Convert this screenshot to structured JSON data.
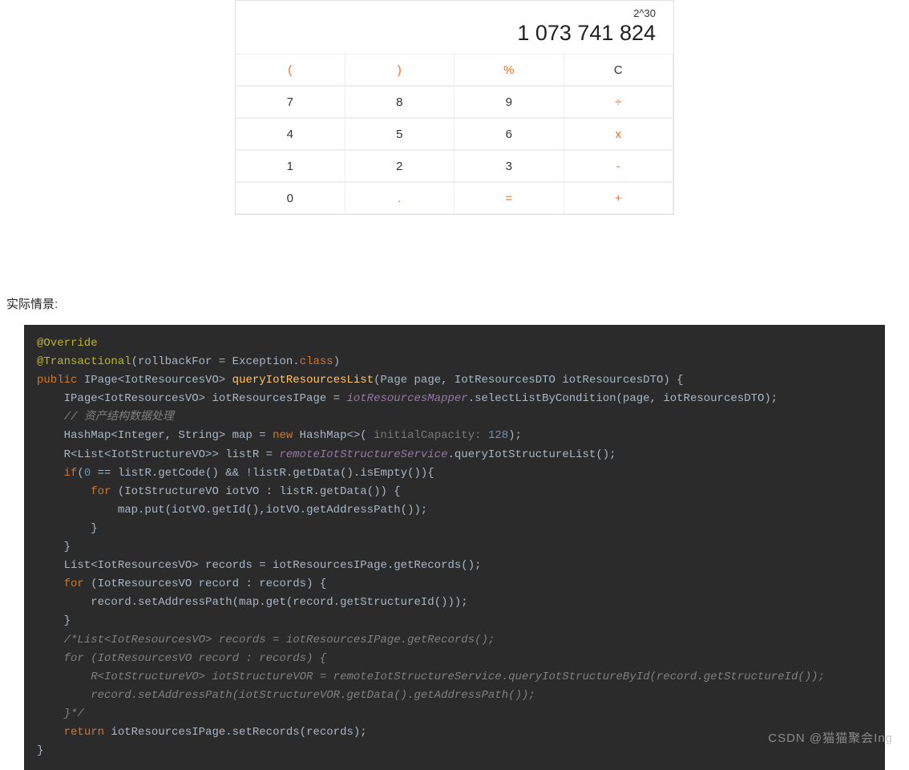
{
  "calculator": {
    "expression": "2^30",
    "result": "1 073 741 824",
    "rows": [
      [
        {
          "label": "(",
          "orange": true
        },
        {
          "label": ")",
          "orange": true
        },
        {
          "label": "%",
          "orange": true
        },
        {
          "label": "C",
          "orange": false
        }
      ],
      [
        {
          "label": "7",
          "orange": false
        },
        {
          "label": "8",
          "orange": false
        },
        {
          "label": "9",
          "orange": false
        },
        {
          "label": "÷",
          "orange": true
        }
      ],
      [
        {
          "label": "4",
          "orange": false
        },
        {
          "label": "5",
          "orange": false
        },
        {
          "label": "6",
          "orange": false
        },
        {
          "label": "x",
          "orange": true
        }
      ],
      [
        {
          "label": "1",
          "orange": false
        },
        {
          "label": "2",
          "orange": false
        },
        {
          "label": "3",
          "orange": false
        },
        {
          "label": "-",
          "orange": true
        }
      ],
      [
        {
          "label": "0",
          "orange": false
        },
        {
          "label": ".",
          "orange": true
        },
        {
          "label": "=",
          "orange": true
        },
        {
          "label": "+",
          "orange": true
        }
      ]
    ]
  },
  "heading": "实际情景:",
  "code": {
    "line1_ann": "@Override",
    "line2_ann": "@Transactional",
    "line2_param": "rollbackFor",
    "line2_cls": "Exception",
    "line2_class_kw": "class",
    "line3_public": "public",
    "line3_ret": "IPage<IotResourcesVO>",
    "line3_method": "queryIotResourcesList",
    "line3_params": "(Page page, IotResourcesDTO iotResourcesDTO) {",
    "line4": "IPage<IotResourcesVO> iotResourcesIPage = ",
    "line4_field": "iotResourcesMapper",
    "line4_rest": ".selectListByCondition(page, iotResourcesDTO);",
    "line5_comment": "// 资产结构数据处理",
    "line6a": "HashMap<Integer, String> map = ",
    "line6_new": "new",
    "line6b": " HashMap<>(",
    "line6_hint": " initialCapacity: ",
    "line6_num": "128",
    "line6c": ");",
    "line7a": "R<List<IotStructureVO>> listR = ",
    "line7_field": "remoteIotStructureService",
    "line7b": ".queryIotStructureList();",
    "line8_if": "if",
    "line8a": "(",
    "line8_zero": "0",
    "line8b": " == listR.getCode() && !listR.getData().isEmpty()){",
    "line9_for": "for",
    "line9": " (IotStructureVO iotVO : listR.getData()) {",
    "line10": "map.put(iotVO.getId(),iotVO.getAddressPath());",
    "line11": "}",
    "line12": "}",
    "line13": "List<IotResourcesVO> records = iotResourcesIPage.getRecords();",
    "line14_for": "for",
    "line14": " (IotResourcesVO record : records) {",
    "line15": "record.setAddressPath(map.get(record.getStructureId()));",
    "line16": "}",
    "line17_comment": "/*List<IotResourcesVO> records = iotResourcesIPage.getRecords();",
    "line18_comment": "for (IotResourcesVO record : records) {",
    "line19_comment": "    R<IotStructureVO> iotStructureVOR = remoteIotStructureService.queryIotStructureById(record.getStructureId());",
    "line20_comment": "    record.setAddressPath(iotStructureVOR.getData().getAddressPath());",
    "line21_comment": "}*/",
    "line22_return": "return",
    "line22": " iotResourcesIPage.setRecords(records);",
    "line23": "}"
  },
  "watermark": "CSDN @猫猫聚会Ing"
}
